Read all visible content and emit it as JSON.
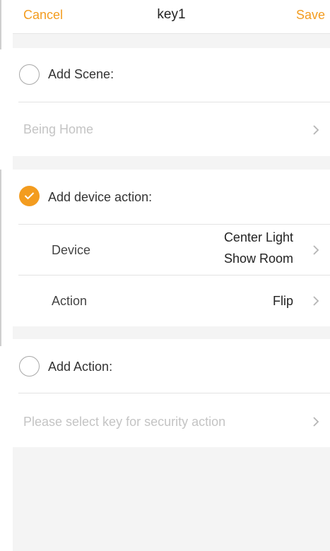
{
  "header": {
    "cancel_label": "Cancel",
    "title": "key1",
    "save_label": "Save"
  },
  "scene_section": {
    "label": "Add Scene:",
    "checked": false,
    "value": "Being Home"
  },
  "device_section": {
    "label": "Add device action:",
    "checked": true,
    "rows": [
      {
        "label": "Device",
        "value_line1": "Center Light",
        "value_line2": "Show Room"
      },
      {
        "label": "Action",
        "value": "Flip"
      }
    ]
  },
  "action_section": {
    "label": "Add Action:",
    "checked": false,
    "value": "Please select key for security action"
  },
  "colors": {
    "accent": "#f39c1f",
    "background": "#f4f4f4",
    "placeholder_text": "#c4c4c4"
  },
  "icons": [
    "radio-unchecked",
    "radio-checked-icon",
    "chevron-right-icon"
  ]
}
